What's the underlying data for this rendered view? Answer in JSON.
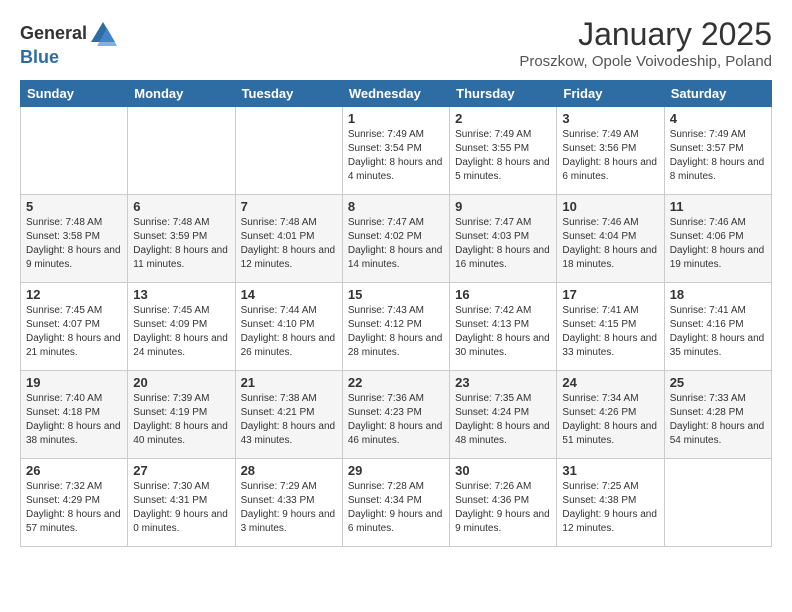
{
  "header": {
    "logo_general": "General",
    "logo_blue": "Blue",
    "month_title": "January 2025",
    "location": "Proszkow, Opole Voivodeship, Poland"
  },
  "weekdays": [
    "Sunday",
    "Monday",
    "Tuesday",
    "Wednesday",
    "Thursday",
    "Friday",
    "Saturday"
  ],
  "weeks": [
    [
      {
        "day": "",
        "info": ""
      },
      {
        "day": "",
        "info": ""
      },
      {
        "day": "",
        "info": ""
      },
      {
        "day": "1",
        "info": "Sunrise: 7:49 AM\nSunset: 3:54 PM\nDaylight: 8 hours\nand 4 minutes."
      },
      {
        "day": "2",
        "info": "Sunrise: 7:49 AM\nSunset: 3:55 PM\nDaylight: 8 hours\nand 5 minutes."
      },
      {
        "day": "3",
        "info": "Sunrise: 7:49 AM\nSunset: 3:56 PM\nDaylight: 8 hours\nand 6 minutes."
      },
      {
        "day": "4",
        "info": "Sunrise: 7:49 AM\nSunset: 3:57 PM\nDaylight: 8 hours\nand 8 minutes."
      }
    ],
    [
      {
        "day": "5",
        "info": "Sunrise: 7:48 AM\nSunset: 3:58 PM\nDaylight: 8 hours\nand 9 minutes."
      },
      {
        "day": "6",
        "info": "Sunrise: 7:48 AM\nSunset: 3:59 PM\nDaylight: 8 hours\nand 11 minutes."
      },
      {
        "day": "7",
        "info": "Sunrise: 7:48 AM\nSunset: 4:01 PM\nDaylight: 8 hours\nand 12 minutes."
      },
      {
        "day": "8",
        "info": "Sunrise: 7:47 AM\nSunset: 4:02 PM\nDaylight: 8 hours\nand 14 minutes."
      },
      {
        "day": "9",
        "info": "Sunrise: 7:47 AM\nSunset: 4:03 PM\nDaylight: 8 hours\nand 16 minutes."
      },
      {
        "day": "10",
        "info": "Sunrise: 7:46 AM\nSunset: 4:04 PM\nDaylight: 8 hours\nand 18 minutes."
      },
      {
        "day": "11",
        "info": "Sunrise: 7:46 AM\nSunset: 4:06 PM\nDaylight: 8 hours\nand 19 minutes."
      }
    ],
    [
      {
        "day": "12",
        "info": "Sunrise: 7:45 AM\nSunset: 4:07 PM\nDaylight: 8 hours\nand 21 minutes."
      },
      {
        "day": "13",
        "info": "Sunrise: 7:45 AM\nSunset: 4:09 PM\nDaylight: 8 hours\nand 24 minutes."
      },
      {
        "day": "14",
        "info": "Sunrise: 7:44 AM\nSunset: 4:10 PM\nDaylight: 8 hours\nand 26 minutes."
      },
      {
        "day": "15",
        "info": "Sunrise: 7:43 AM\nSunset: 4:12 PM\nDaylight: 8 hours\nand 28 minutes."
      },
      {
        "day": "16",
        "info": "Sunrise: 7:42 AM\nSunset: 4:13 PM\nDaylight: 8 hours\nand 30 minutes."
      },
      {
        "day": "17",
        "info": "Sunrise: 7:41 AM\nSunset: 4:15 PM\nDaylight: 8 hours\nand 33 minutes."
      },
      {
        "day": "18",
        "info": "Sunrise: 7:41 AM\nSunset: 4:16 PM\nDaylight: 8 hours\nand 35 minutes."
      }
    ],
    [
      {
        "day": "19",
        "info": "Sunrise: 7:40 AM\nSunset: 4:18 PM\nDaylight: 8 hours\nand 38 minutes."
      },
      {
        "day": "20",
        "info": "Sunrise: 7:39 AM\nSunset: 4:19 PM\nDaylight: 8 hours\nand 40 minutes."
      },
      {
        "day": "21",
        "info": "Sunrise: 7:38 AM\nSunset: 4:21 PM\nDaylight: 8 hours\nand 43 minutes."
      },
      {
        "day": "22",
        "info": "Sunrise: 7:36 AM\nSunset: 4:23 PM\nDaylight: 8 hours\nand 46 minutes."
      },
      {
        "day": "23",
        "info": "Sunrise: 7:35 AM\nSunset: 4:24 PM\nDaylight: 8 hours\nand 48 minutes."
      },
      {
        "day": "24",
        "info": "Sunrise: 7:34 AM\nSunset: 4:26 PM\nDaylight: 8 hours\nand 51 minutes."
      },
      {
        "day": "25",
        "info": "Sunrise: 7:33 AM\nSunset: 4:28 PM\nDaylight: 8 hours\nand 54 minutes."
      }
    ],
    [
      {
        "day": "26",
        "info": "Sunrise: 7:32 AM\nSunset: 4:29 PM\nDaylight: 8 hours\nand 57 minutes."
      },
      {
        "day": "27",
        "info": "Sunrise: 7:30 AM\nSunset: 4:31 PM\nDaylight: 9 hours\nand 0 minutes."
      },
      {
        "day": "28",
        "info": "Sunrise: 7:29 AM\nSunset: 4:33 PM\nDaylight: 9 hours\nand 3 minutes."
      },
      {
        "day": "29",
        "info": "Sunrise: 7:28 AM\nSunset: 4:34 PM\nDaylight: 9 hours\nand 6 minutes."
      },
      {
        "day": "30",
        "info": "Sunrise: 7:26 AM\nSunset: 4:36 PM\nDaylight: 9 hours\nand 9 minutes."
      },
      {
        "day": "31",
        "info": "Sunrise: 7:25 AM\nSunset: 4:38 PM\nDaylight: 9 hours\nand 12 minutes."
      },
      {
        "day": "",
        "info": ""
      }
    ]
  ]
}
